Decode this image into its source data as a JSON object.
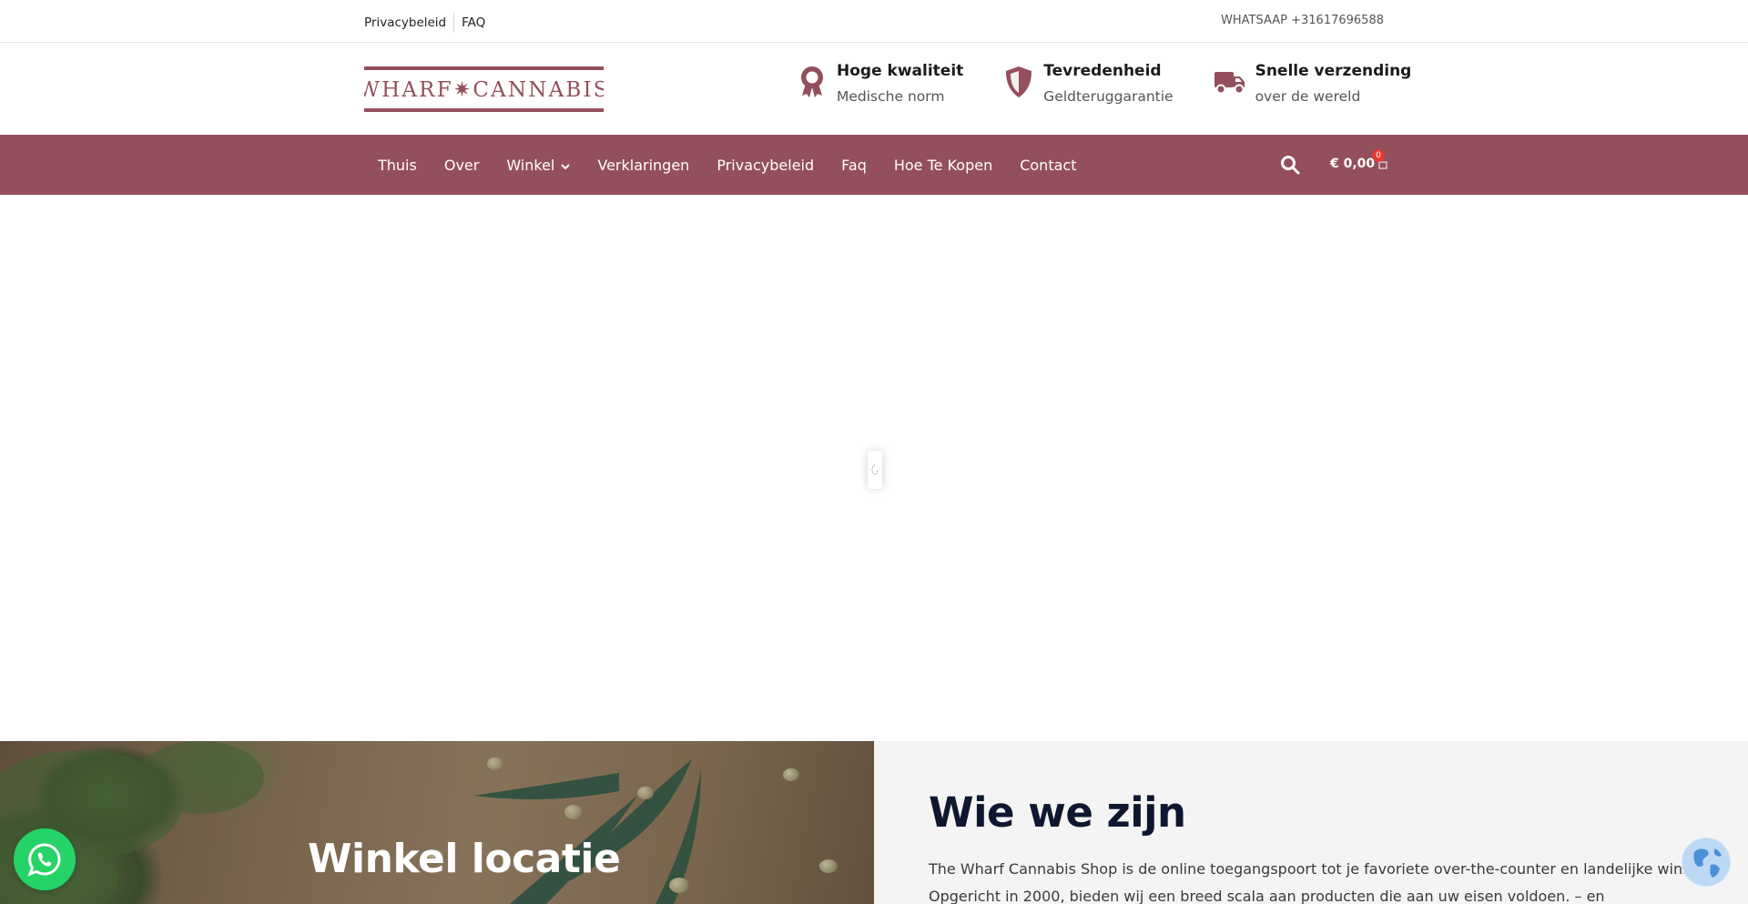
{
  "topbar": {
    "links": [
      "Privacybeleid",
      "FAQ"
    ],
    "whatsapp": "WHATSAAP +31617696588"
  },
  "header": {
    "logo_text": "WHARF✷CANNABIS",
    "features": [
      {
        "icon": "award-ribbon-icon",
        "title": "Hoge kwaliteit",
        "subtitle": "Medische norm"
      },
      {
        "icon": "shield-icon",
        "title": "Tevredenheid",
        "subtitle": "Geldteruggarantie"
      },
      {
        "icon": "truck-icon",
        "title": "Snelle verzending",
        "subtitle": "over de wereld"
      }
    ]
  },
  "nav": {
    "items": [
      "Thuis",
      "Over",
      "Winkel",
      "Verklaringen",
      "Privacybeleid",
      "Faq",
      "Hoe Te Kopen",
      "Contact"
    ],
    "cart_total": "€ 0,00",
    "cart_count": "0"
  },
  "hero": {
    "title": "Winkel locatie"
  },
  "about": {
    "heading": "Wie we zijn",
    "text": "The Wharf Cannabis Shop is de online toegangspoort tot je favoriete over-the-counter en landelijke winkel. Opgericht in 2000, bieden wij een breed scala aan producten die aan uw eisen voldoen. – en groentewinkel."
  },
  "colors": {
    "brand": "#944f5c",
    "whatsapp": "#25d366",
    "badge": "#e53935"
  }
}
